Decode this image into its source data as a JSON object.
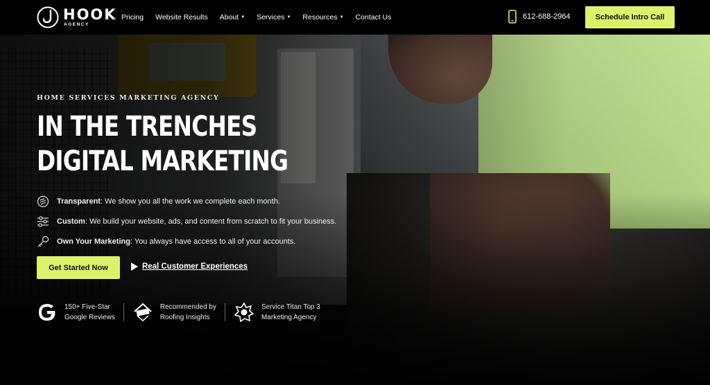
{
  "brand": {
    "name": "HOOK",
    "sub": "AGENCY"
  },
  "nav": {
    "items": [
      {
        "label": "Pricing",
        "dropdown": false
      },
      {
        "label": "Website Results",
        "dropdown": false
      },
      {
        "label": "About",
        "dropdown": true
      },
      {
        "label": "Services",
        "dropdown": true
      },
      {
        "label": "Resources",
        "dropdown": true
      },
      {
        "label": "Contact Us",
        "dropdown": false
      }
    ]
  },
  "header": {
    "phone": "612-688-2964",
    "phone_icon": "phone-icon",
    "cta_label": "Schedule Intro Call"
  },
  "hero": {
    "eyebrow": "HOME SERVICES MARKETING AGENCY",
    "headline_line1": "IN THE TRENCHES",
    "headline_line2": "DIGITAL MARKETING",
    "features": [
      {
        "icon": "layers-icon",
        "title": "Transparent",
        "text": ": We show you all the work we complete each month."
      },
      {
        "icon": "sliders-icon",
        "title": "Custom",
        "text": ": We build your website, ads, and content from scratch to fit your business."
      },
      {
        "icon": "key-icon",
        "title": "Own Your Marketing",
        "text": ": You always have access to all of your accounts."
      }
    ],
    "primary_cta": "Get Started Now",
    "video_link": "Real Customer Experiences"
  },
  "badges": [
    {
      "icon": "google-g-icon",
      "line1": "150+ Five-Star",
      "line2": "Google Reviews"
    },
    {
      "icon": "roofing-insights-icon",
      "line1": "Recommended by",
      "line2": "Roofing Insights"
    },
    {
      "icon": "service-titan-icon",
      "line1": "Service Titan Top 3",
      "line2": "Marketing Agency"
    }
  ],
  "colors": {
    "accent": "#dcf26b",
    "background": "#000000",
    "text": "#ffffff"
  }
}
